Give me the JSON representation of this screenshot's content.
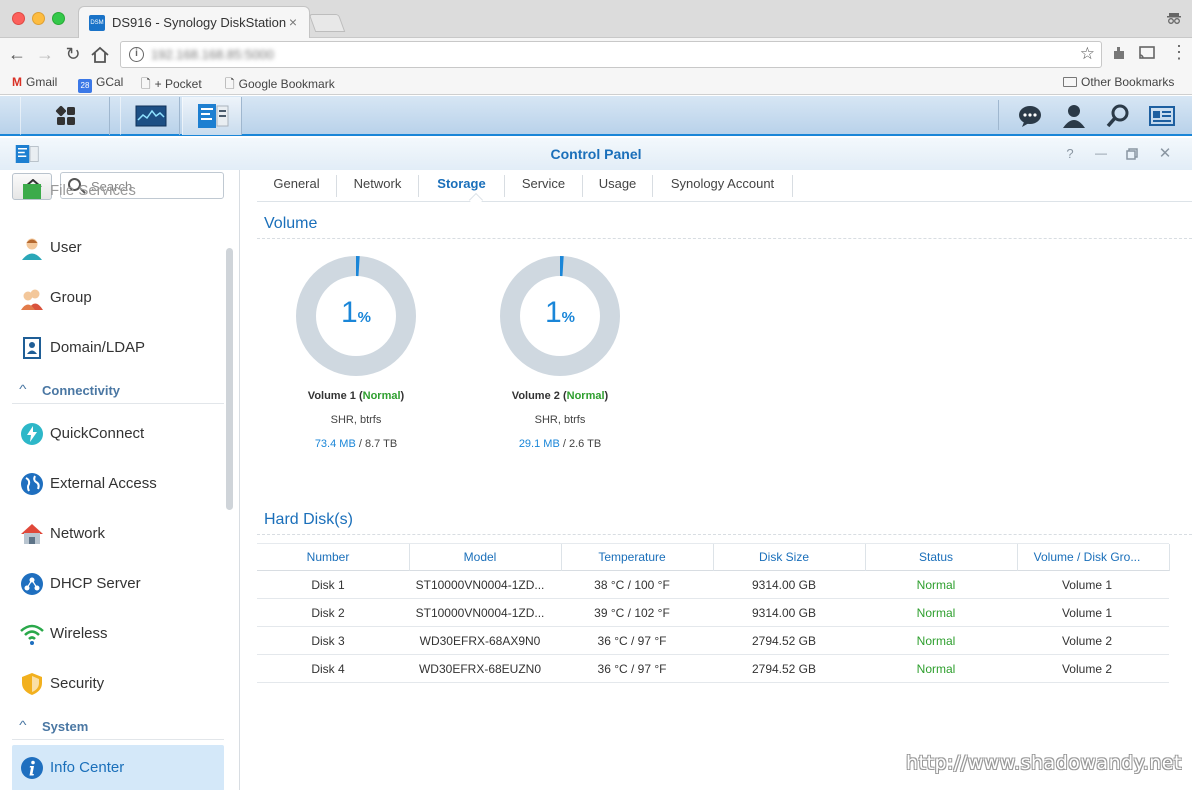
{
  "browser": {
    "tab_title": "DS916 - Synology DiskStation",
    "tab_close": "×",
    "url": "192.168.168.85:5000",
    "bookmarks": [
      {
        "label": "Gmail",
        "icon": "gmail-icon"
      },
      {
        "label": "GCal",
        "icon": "calendar-icon",
        "badge": "28"
      },
      {
        "label": "+ Pocket",
        "icon": "page-icon"
      },
      {
        "label": "Google Bookmark",
        "icon": "page-icon"
      }
    ],
    "other_bookmarks": "Other Bookmarks"
  },
  "window": {
    "title": "Control Panel",
    "help": "?",
    "minimize": "—",
    "close": "✕"
  },
  "sidebar": {
    "search_placeholder": "Search",
    "partial_item": "File Services",
    "items_a": [
      {
        "label": "User",
        "icon": "user-icon"
      },
      {
        "label": "Group",
        "icon": "group-icon"
      },
      {
        "label": "Domain/LDAP",
        "icon": "domain-ldap-icon"
      }
    ],
    "section_connectivity": "Connectivity",
    "items_b": [
      {
        "label": "QuickConnect",
        "icon": "quickconnect-icon"
      },
      {
        "label": "External Access",
        "icon": "globe-icon"
      },
      {
        "label": "Network",
        "icon": "house-network-icon"
      },
      {
        "label": "DHCP Server",
        "icon": "dhcp-icon"
      },
      {
        "label": "Wireless",
        "icon": "wifi-icon"
      },
      {
        "label": "Security",
        "icon": "shield-icon"
      }
    ],
    "section_system": "System",
    "active_item": {
      "label": "Info Center",
      "icon": "info-icon"
    }
  },
  "tabs": [
    "General",
    "Network",
    "Storage",
    "Service",
    "Usage",
    "Synology Account"
  ],
  "active_tab": "Storage",
  "volume_section_title": "Volume",
  "volumes": [
    {
      "pct": "1",
      "pct_sign": "%",
      "usage_fraction": 0.01,
      "name": "Volume 1",
      "status": "Normal",
      "fs": "SHR, btrfs",
      "used": "73.4 MB",
      "total": "8.7 TB"
    },
    {
      "pct": "1",
      "pct_sign": "%",
      "usage_fraction": 0.01,
      "name": "Volume 2",
      "status": "Normal",
      "fs": "SHR, btrfs",
      "used": "29.1 MB",
      "total": "2.6 TB"
    }
  ],
  "disks_section_title": "Hard Disk(s)",
  "disk_columns": [
    "Number",
    "Model",
    "Temperature",
    "Disk Size",
    "Status",
    "Volume / Disk Gro..."
  ],
  "disks": [
    {
      "number": "Disk 1",
      "model": "ST10000VN0004-1ZD...",
      "temperature": "38 °C / 100 °F",
      "size": "9314.00 GB",
      "status": "Normal",
      "volume": "Volume 1"
    },
    {
      "number": "Disk 2",
      "model": "ST10000VN0004-1ZD...",
      "temperature": "39 °C / 102 °F",
      "size": "9314.00 GB",
      "status": "Normal",
      "volume": "Volume 1"
    },
    {
      "number": "Disk 3",
      "model": "WD30EFRX-68AX9N0",
      "temperature": "36 °C / 97 °F",
      "size": "2794.52 GB",
      "status": "Normal",
      "volume": "Volume 2"
    },
    {
      "number": "Disk 4",
      "model": "WD30EFRX-68EUZN0",
      "temperature": "36 °C / 97 °F",
      "size": "2794.52 GB",
      "status": "Normal",
      "volume": "Volume 2"
    }
  ],
  "watermark": "http://www.shadowandy.net",
  "colors": {
    "accent": "#1a6fba",
    "status_ok": "#2e9f2e",
    "donut_track": "#cfd8e0"
  }
}
